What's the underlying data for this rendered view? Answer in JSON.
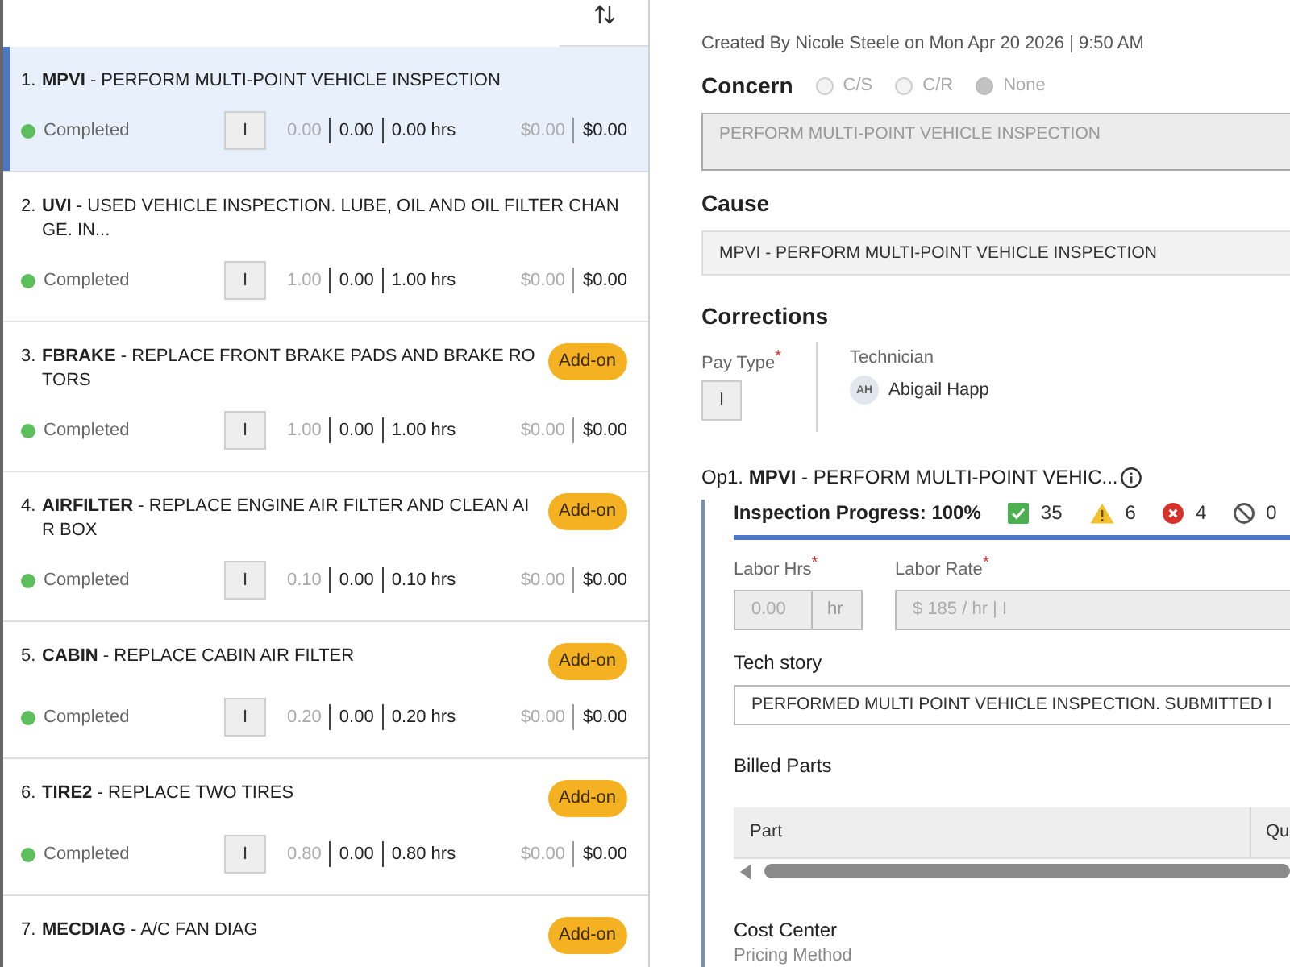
{
  "repair_lines": [
    {
      "number": "1.",
      "title": "**MPVI** - PERFORM MULTI-POINT VEHICLE INSPECTION",
      "selected": true,
      "status": "Completed",
      "pay_type": "I",
      "hours": [
        "0.00",
        "0.00",
        "0.00 hrs"
      ],
      "amounts": [
        "$0.00",
        "$0.00"
      ]
    },
    {
      "number": "2.",
      "title": "**UVI** - USED VEHICLE INSPECTION. LUBE, OIL AND OIL FILTER CHANGE. IN...",
      "selected": false,
      "status": "Completed",
      "pay_type": "I",
      "hours": [
        "1.00",
        "0.00",
        "1.00 hrs"
      ],
      "amounts": [
        "$0.00",
        "$0.00"
      ]
    },
    {
      "number": "3.",
      "title": "**FBRAKE** - REPLACE FRONT BRAKE PADS AND BRAKE ROTORS",
      "selected": false,
      "badge": "Add-on",
      "status": "Completed",
      "pay_type": "I",
      "hours": [
        "1.00",
        "0.00",
        "1.00 hrs"
      ],
      "amounts": [
        "$0.00",
        "$0.00"
      ]
    },
    {
      "number": "4.",
      "title": "**AIRFILTER** - REPLACE ENGINE AIR FILTER AND CLEAN AIR BOX",
      "selected": false,
      "badge": "Add-on",
      "status": "Completed",
      "pay_type": "I",
      "hours": [
        "0.10",
        "0.00",
        "0.10 hrs"
      ],
      "amounts": [
        "$0.00",
        "$0.00"
      ]
    },
    {
      "number": "5.",
      "title": "**CABIN** - REPLACE CABIN AIR FILTER",
      "selected": false,
      "badge": "Add-on",
      "status": "Completed",
      "pay_type": "I",
      "hours": [
        "0.20",
        "0.00",
        "0.20 hrs"
      ],
      "amounts": [
        "$0.00",
        "$0.00"
      ]
    },
    {
      "number": "6.",
      "title": "**TIRE2** - REPLACE TWO TIRES",
      "selected": false,
      "badge": "Add-on",
      "status": "Completed",
      "pay_type": "I",
      "hours": [
        "0.80",
        "0.00",
        "0.80 hrs"
      ],
      "amounts": [
        "$0.00",
        "$0.00"
      ]
    },
    {
      "number": "7.",
      "title": "**MECDIAG** - A/C FAN DIAG",
      "selected": false,
      "badge": "Add-on"
    }
  ],
  "detail": {
    "created": "Created By Nicole Steele on Mon Apr 20 2026 | 9:50 AM",
    "concern": {
      "label": "Concern",
      "disabled": true,
      "options": [
        {
          "label": "C/S",
          "selected": false
        },
        {
          "label": "C/R",
          "selected": false
        },
        {
          "label": "None",
          "selected": true
        }
      ],
      "value": "PERFORM MULTI-POINT VEHICLE INSPECTION"
    },
    "cause": {
      "label": "Cause",
      "value": "MPVI - PERFORM MULTI-POINT VEHICLE INSPECTION"
    },
    "corrections": {
      "label": "Corrections",
      "pay_type": {
        "label": "Pay Type$^{*}$",
        "value": "I"
      },
      "technician": {
        "label": "Technician",
        "initials": "AH",
        "name": "Abigail Happ"
      }
    },
    "operation": {
      "title": "Op1. **MPVI** - PERFORM MULTI-POINT VEHIC...",
      "inspection": {
        "label": "Inspection Progress: 100%",
        "level": 1,
        "counts": [
          {
            "kind": "passed",
            "value": "35"
          },
          {
            "kind": "warning",
            "value": "6"
          },
          {
            "kind": "failed",
            "value": "4"
          },
          {
            "kind": "skipped",
            "value": "0"
          }
        ]
      },
      "labor_hours": {
        "label": "Labor Hrs$^{*}$",
        "value": "0.00",
        "unit": "hr",
        "disabled": true
      },
      "labor_rate": {
        "label": "Labor Rate$^{*}$",
        "value": "$ 185 / hr | I",
        "disabled": true
      },
      "tech_story": {
        "label": "Tech story",
        "value": "PERFORMED MULTI POINT VEHICLE INSPECTION. SUBMITTED I"
      },
      "billed_parts": {
        "label": "Billed Parts",
        "columns": [
          "Part",
          "Qu"
        ]
      },
      "cost_center": {
        "label": "Cost Center"
      },
      "pricing_method": {
        "label": "Pricing Method"
      }
    }
  }
}
